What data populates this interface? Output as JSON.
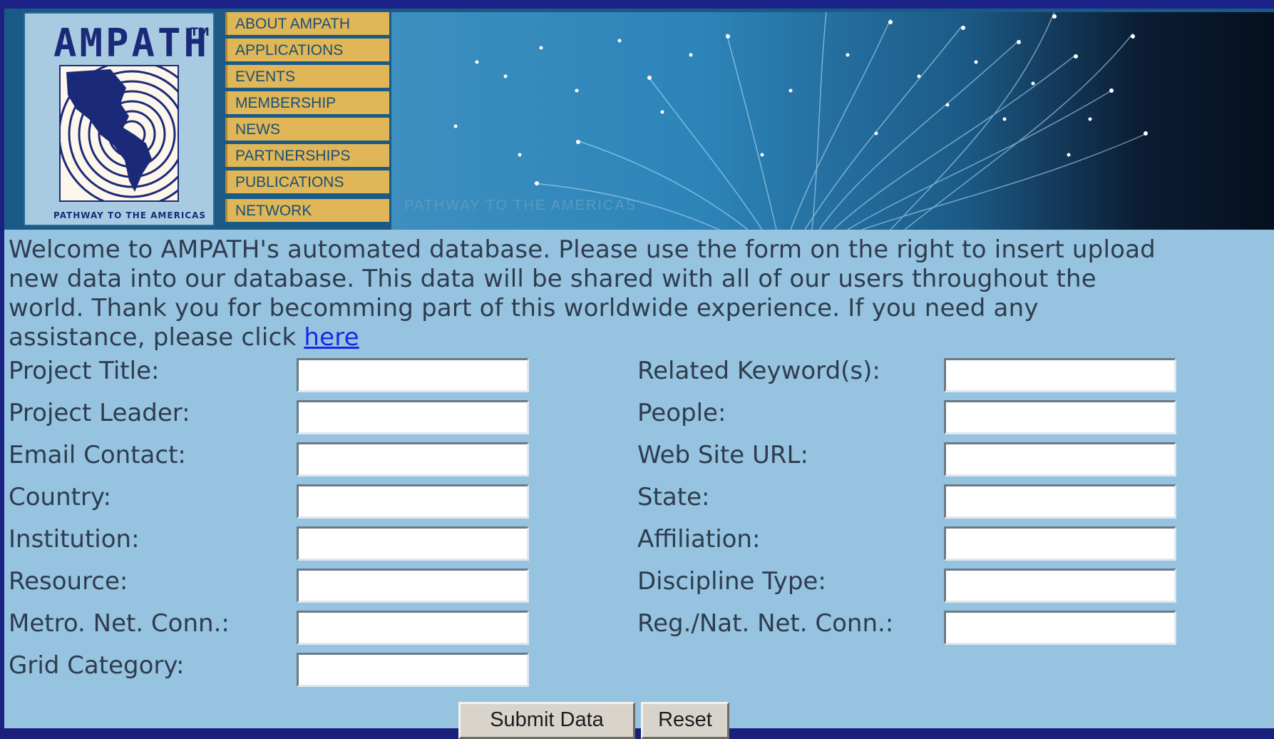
{
  "logo": {
    "name": "AMPATH",
    "tm": "TM",
    "tagline": "PATHWAY TO THE AMERICAS"
  },
  "nav": {
    "items": [
      {
        "label": "ABOUT AMPATH"
      },
      {
        "label": "APPLICATIONS"
      },
      {
        "label": "EVENTS"
      },
      {
        "label": "MEMBERSHIP"
      },
      {
        "label": "NEWS"
      },
      {
        "label": "PARTNERSHIPS"
      },
      {
        "label": "PUBLICATIONS"
      },
      {
        "label": "NETWORK"
      }
    ]
  },
  "banner": {
    "caption": "PATHWAY TO THE AMERICAS"
  },
  "intro": {
    "line1": "Welcome to AMPATH's automated database. Please use the form on the right to insert upload",
    "line2": "new data into our database. This data will be shared with all of our users throughout the",
    "line3": "world. Thank you for becomming part of this worldwide experience. If you need any",
    "line4_prefix": "assistance, please click ",
    "link": "here"
  },
  "form": {
    "left": [
      {
        "label": "Project Title:",
        "value": ""
      },
      {
        "label": "Project Leader:",
        "value": ""
      },
      {
        "label": "Email Contact:",
        "value": ""
      },
      {
        "label": "Country:",
        "value": ""
      },
      {
        "label": "Institution:",
        "value": ""
      },
      {
        "label": "Resource:",
        "value": ""
      },
      {
        "label": "Metro. Net. Conn.:",
        "value": ""
      },
      {
        "label": "Grid Category:",
        "value": ""
      }
    ],
    "right": [
      {
        "label": "Related Keyword(s):",
        "value": ""
      },
      {
        "label": "People:",
        "value": ""
      },
      {
        "label": "Web Site URL:",
        "value": ""
      },
      {
        "label": "State:",
        "value": ""
      },
      {
        "label": "Affiliation:",
        "value": ""
      },
      {
        "label": "Discipline Type:",
        "value": ""
      },
      {
        "label": "Reg./Nat. Net. Conn.:",
        "value": ""
      }
    ],
    "submit_label": "Submit Data",
    "reset_label": "Reset"
  },
  "colors": {
    "page_background": "#96c3df",
    "frame": "#1b2083",
    "nav_button": "#e0b656",
    "link": "#1b27e6"
  }
}
